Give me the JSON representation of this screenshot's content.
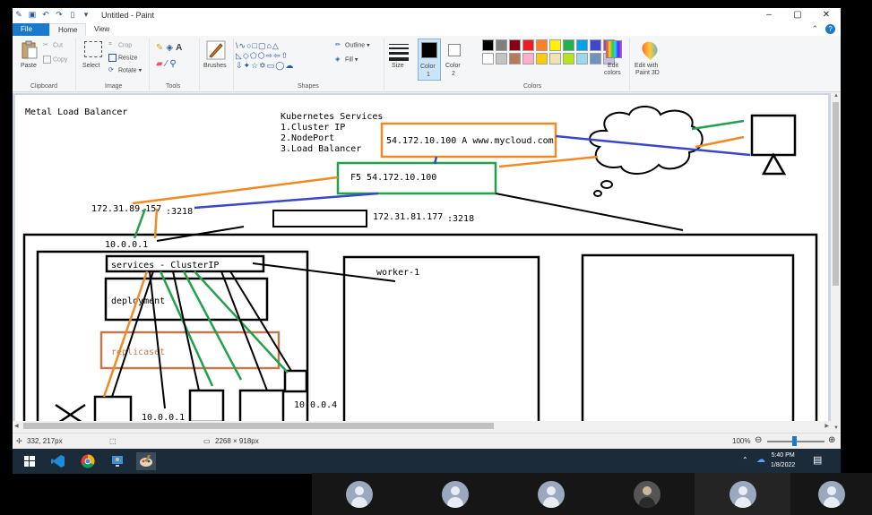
{
  "window": {
    "title": "Untitled - Paint",
    "controls": [
      "–",
      "▢",
      "✕"
    ]
  },
  "tabs": {
    "file": "File",
    "home": "Home",
    "view": "View"
  },
  "ribbon": {
    "clipboard": {
      "label": "Clipboard",
      "paste": "Paste",
      "cut": "Cut",
      "copy": "Copy"
    },
    "image": {
      "label": "Image",
      "select": "Select",
      "crop": "Crop",
      "resize": "Resize",
      "rotate": "Rotate ▾"
    },
    "tools": {
      "label": "Tools"
    },
    "brushes": "Brushes",
    "shapes": {
      "label": "Shapes",
      "outline": "Outline ▾",
      "fill": "Fill ▾"
    },
    "size": "Size",
    "color1": {
      "line1": "Color",
      "line2": "1"
    },
    "color2": {
      "line1": "Color",
      "line2": "2"
    },
    "colors": {
      "label": "Colors"
    },
    "edit_colors": {
      "line1": "Edit",
      "line2": "colors"
    },
    "paint3d": {
      "line1": "Edit with",
      "line2": "Paint 3D"
    },
    "palette": [
      "#000000",
      "#7f7f7f",
      "#880015",
      "#ed1c24",
      "#ff7f27",
      "#fff200",
      "#22b14c",
      "#00a2e8",
      "#3f48cc",
      "#a349a4",
      "#ffffff",
      "#c3c3c3",
      "#b97a57",
      "#ffaec9",
      "#ffc90e",
      "#efe4b0",
      "#b5e61d",
      "#99d9ea",
      "#7092be",
      "#c8bfe7"
    ]
  },
  "drawing": {
    "metal_lb": "Metal Load Balancer",
    "k8s_title": "Kubernetes Services",
    "k8s_1": "1.Cluster IP",
    "k8s_2": "2.NodePort",
    "k8s_3": "3.Load Balancer",
    "dns": "54.172.10.100 A www.mycloud.com",
    "f5": "F5  54.172.10.100",
    "ip_left": "172.31.89.157",
    "port_left": ":3218",
    "ip_right": "172.31.81.177",
    "port_right": ":3218",
    "node_ip": "10.0.0.1",
    "services": "services - ClusterIP",
    "worker": "worker-1",
    "deployment": "deployment",
    "replicaset": "replicaset",
    "pod_ip1": "10.0.0.1",
    "pod_ip4": "10.0.0.4"
  },
  "status": {
    "cursor": "332, 217px",
    "selection": "",
    "canvas_size": "2268 × 918px",
    "zoom": "100%"
  },
  "taskbar": {
    "time": "5:40 PM",
    "date": "1/8/2022"
  }
}
